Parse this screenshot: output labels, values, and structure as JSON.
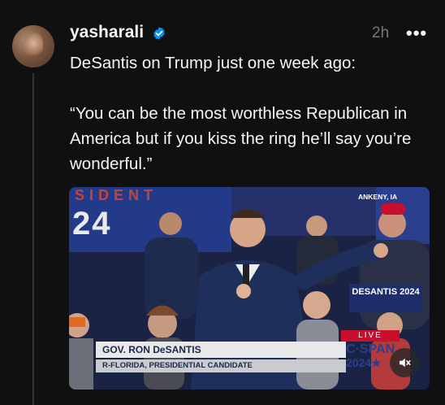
{
  "post": {
    "username": "yasharali",
    "verified": true,
    "time": "2h",
    "more_icon": "more-horizontal-icon",
    "text": "DeSantis on Trump just one week ago:\n\n“You can be the most worthless Republican in America but if you kiss the ring he’ll say you’re wonderful.”"
  },
  "media": {
    "location": "ANKENY, IA",
    "banner_left": "SIDENT",
    "banner_number": "24",
    "lower_third_name": "GOV. RON DeSANTIS",
    "lower_third_sub": "R-FLORIDA, PRESIDENTIAL CANDIDATE",
    "live_label": "LIVE",
    "network": "C·SPAN",
    "network_year": "2024★",
    "sign_text": "DESANTIS 2024",
    "mute_icon": "speaker-muted-icon"
  },
  "colors": {
    "background": "#101010",
    "text": "#f3f5f7",
    "secondary_text": "#777777",
    "verified_blue": "#0095f6"
  }
}
